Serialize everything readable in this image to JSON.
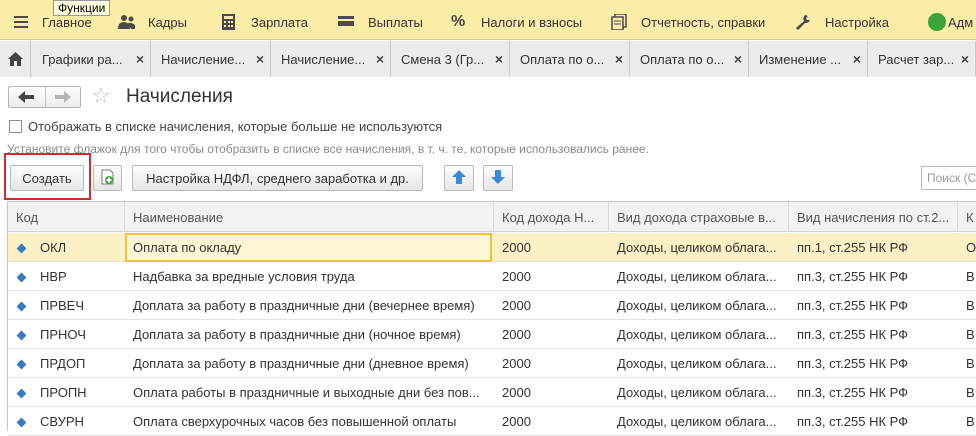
{
  "menu": {
    "tooltip": "Функции",
    "items": [
      {
        "label": "Главное",
        "icon": "hamburger-icon"
      },
      {
        "label": "Кадры",
        "icon": "people-icon"
      },
      {
        "label": "Зарплата",
        "icon": "calculator-icon"
      },
      {
        "label": "Выплаты",
        "icon": "wallet-icon"
      },
      {
        "label": "Налоги и взносы",
        "icon": "percent-icon"
      },
      {
        "label": "Отчетность, справки",
        "icon": "reports-icon"
      },
      {
        "label": "Настройка",
        "icon": "wrench-icon"
      },
      {
        "label": "Адм",
        "icon": "admin-icon"
      }
    ]
  },
  "tabs": [
    {
      "label": "Графики ра..."
    },
    {
      "label": "Начисление..."
    },
    {
      "label": "Начисление..."
    },
    {
      "label": "Смена 3 (Гр..."
    },
    {
      "label": "Оплата по о..."
    },
    {
      "label": "Оплата по о..."
    },
    {
      "label": "Изменение ..."
    },
    {
      "label": "Расчет зар..."
    }
  ],
  "form": {
    "title": "Начисления",
    "checkbox_label": "Отображать в списке начисления, которые больше не используются",
    "hint": "Установите флажок для того чтобы отобразить в списке все начисления, в т. ч. те, которые использовались ранее.",
    "create_label": "Создать",
    "settings_label": "Настройка НДФЛ, среднего заработка и др.",
    "search_placeholder": "Поиск (Ctrl"
  },
  "table": {
    "columns": [
      "Код",
      "Наименование",
      "Код дохода Н...",
      "Вид дохода страховые в...",
      "Вид начисления по ст.2...",
      "К"
    ],
    "rows": [
      {
        "code": "ОКЛ",
        "name": "Оплата по окладу",
        "income_code": "2000",
        "income_type": "Доходы, целиком облага...",
        "accrual_type": "пп.1, ст.255 НК РФ",
        "extra": "О"
      },
      {
        "code": "НВР",
        "name": "Надбавка за вредные условия труда",
        "income_code": "2000",
        "income_type": "Доходы, целиком облага...",
        "accrual_type": "пп.3, ст.255 НК РФ",
        "extra": "В"
      },
      {
        "code": "ПРВЕЧ",
        "name": "Доплата за работу в праздничные дни (вечернее время)",
        "income_code": "2000",
        "income_type": "Доходы, целиком облага...",
        "accrual_type": "пп.3, ст.255 НК РФ",
        "extra": "В"
      },
      {
        "code": "ПРНОЧ",
        "name": "Доплата за работу в праздничные дни (ночное время)",
        "income_code": "2000",
        "income_type": "Доходы, целиком облага...",
        "accrual_type": "пп.3, ст.255 НК РФ",
        "extra": "В"
      },
      {
        "code": "ПРДОП",
        "name": "Доплата за работу в праздничные дни (дневное время)",
        "income_code": "2000",
        "income_type": "Доходы, целиком облага...",
        "accrual_type": "пп.3, ст.255 НК РФ",
        "extra": "В"
      },
      {
        "code": "ПРОПН",
        "name": "Оплата работы в праздничные и выходные дни без пов...",
        "income_code": "2000",
        "income_type": "Доходы, целиком облага...",
        "accrual_type": "пп.3, ст.255 НК РФ",
        "extra": "В"
      },
      {
        "code": "СВУРН",
        "name": "Оплата сверхурочных часов без повышенной оплаты",
        "income_code": "2000",
        "income_type": "Доходы, целиком облага...",
        "accrual_type": "пп.3, ст.255 НК РФ",
        "extra": "В"
      }
    ]
  },
  "colors": {
    "menubar": "#fbeca8",
    "selected_row": "#fbf1c5",
    "active_cell_border": "#f0c23c",
    "highlight_outline": "#d42c2c",
    "arrow_blue": "#3b8ad9"
  }
}
